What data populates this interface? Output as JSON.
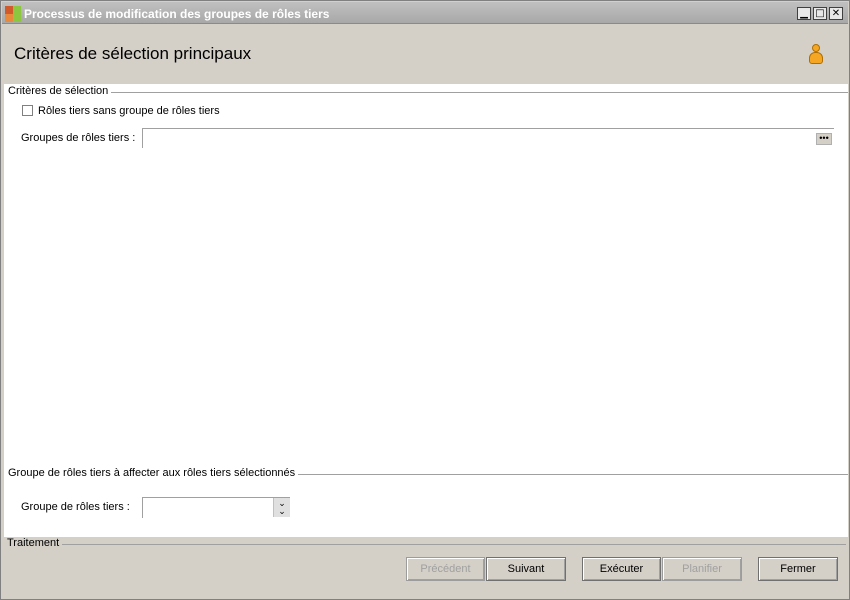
{
  "window": {
    "title": "Processus de modification des groupes de rôles tiers",
    "controls": {
      "minimize": "▁",
      "maximize": "□",
      "close": "✕"
    },
    "icon": "app-icon"
  },
  "header": {
    "title": "Critères de sélection principaux",
    "icon": "user-icon"
  },
  "selection": {
    "group_label": "Critères de sélection",
    "checkbox_label": "Rôles tiers sans groupe de rôles tiers",
    "checkbox_checked": false,
    "groups_label": "Groupes de rôles tiers :",
    "groups_value": "",
    "ellipsis_label": "•••"
  },
  "assign": {
    "group_label": "Groupe de rôles tiers à affecter aux rôles tiers sélectionnés",
    "field_label": "Groupe de rôles tiers :",
    "field_value": "",
    "arrow": "⌄"
  },
  "footer": {
    "label": "Traitement",
    "buttons": {
      "previous": "Précédent",
      "next": "Suivant",
      "execute": "Exécuter",
      "plan": "Planifier",
      "close": "Fermer"
    }
  },
  "colors": {
    "titlebar": "#b0b0b0",
    "background": "#d4d0c8",
    "accent_icon": "#f5a623"
  }
}
